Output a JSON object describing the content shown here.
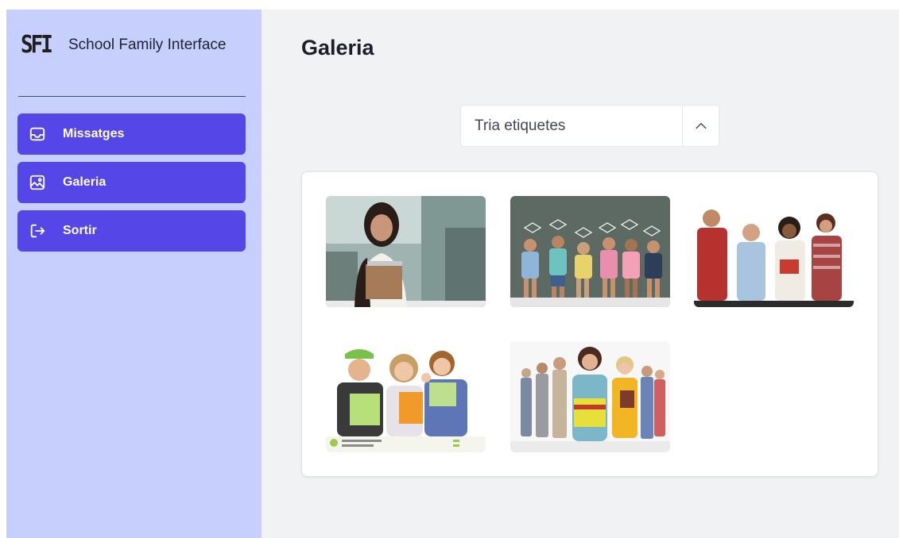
{
  "sidebar": {
    "logo_text": "SFI",
    "app_name": "School Family Interface",
    "items": [
      {
        "label": "Missatges",
        "icon": "inbox-icon"
      },
      {
        "label": "Galeria",
        "icon": "image-icon"
      },
      {
        "label": "Sortir",
        "icon": "logout-icon"
      }
    ]
  },
  "main": {
    "title": "Galeria",
    "tag_select": {
      "placeholder": "Tria etiquetes",
      "toggle_icon": "chevron-up-icon"
    },
    "gallery": {
      "photos": [
        {
          "subject": "student-girl-with-notebooks-photo"
        },
        {
          "subject": "children-with-graduation-caps-photo"
        },
        {
          "subject": "group-of-teen-students-photo"
        },
        {
          "subject": "kids-with-notebooks-photo"
        },
        {
          "subject": "students-group-with-books-photo"
        }
      ]
    }
  },
  "colors": {
    "sidebar_bg": "#c7cffd",
    "nav_button": "#5546e8",
    "main_bg": "#f1f2f3",
    "card_bg": "#ffffff"
  }
}
